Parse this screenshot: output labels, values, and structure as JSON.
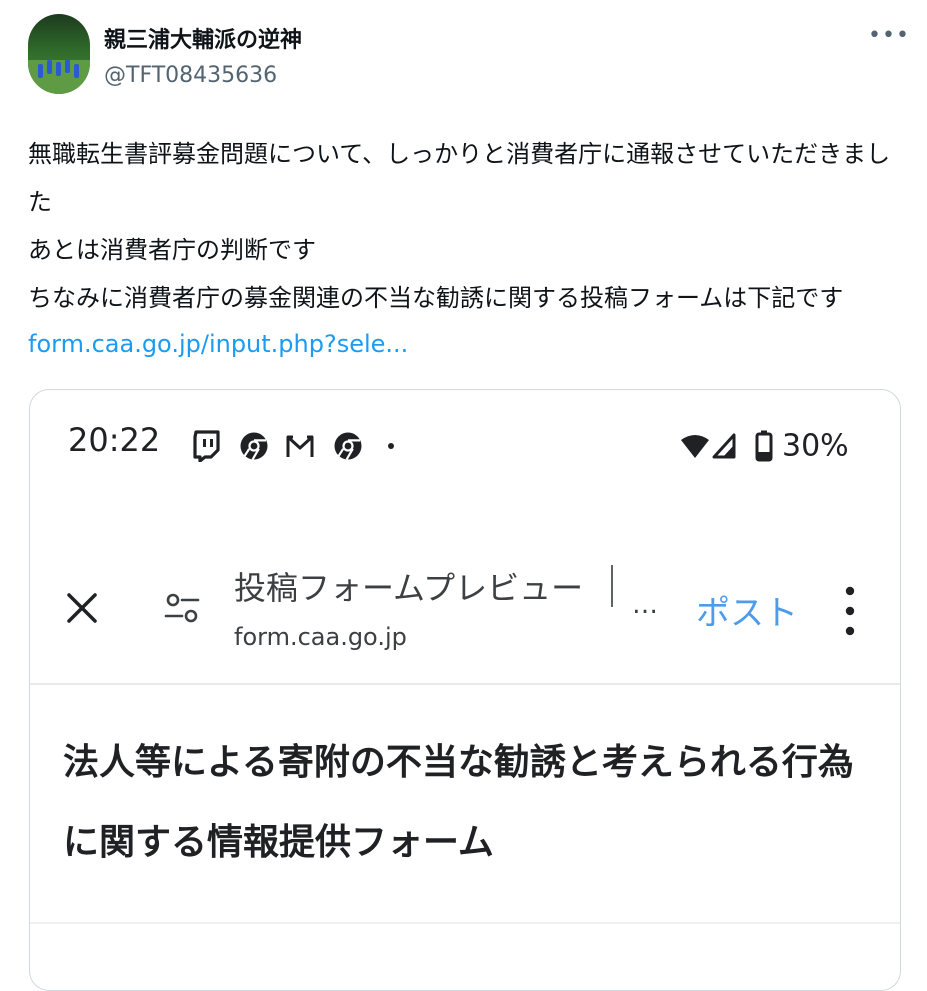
{
  "tweet": {
    "author": {
      "display_name": "親三浦大輔派の逆神",
      "handle": "@TFT08435636",
      "avatar_icon": "baseball-team-photo-avatar"
    },
    "more_icon": "more-icon",
    "more_glyph": "•••",
    "text": "無職転生書評募金問題について、しっかりと消費者庁に通報させていただきました\nあとは消費者庁の判断です\nちなみに消費者庁の募金関連の不当な勧誘に関する投稿フォームは下記です",
    "link": "form.caa.go.jp/input.php?sele..."
  },
  "screenshot": {
    "status_bar": {
      "time": "20:22",
      "icons": [
        "twitch-icon",
        "chrome-icon",
        "gmail-icon",
        "chrome-icon",
        "notification-dot-icon",
        "wifi-icon",
        "cell-signal-icon",
        "battery-icon"
      ],
      "battery": "30%"
    },
    "browser_bar": {
      "page_title": "投稿フォームプレビュー",
      "ellipsis": "…",
      "url": "form.caa.go.jp",
      "action_label": "ポスト"
    },
    "form_heading": "法人等による寄附の不当な勧誘と考えられる行為に関する情報提供フォーム"
  },
  "colors": {
    "link": "#1d9bf0",
    "handle": "#536471",
    "post_button": "#4d9bea",
    "card_border": "#cfd9de"
  }
}
